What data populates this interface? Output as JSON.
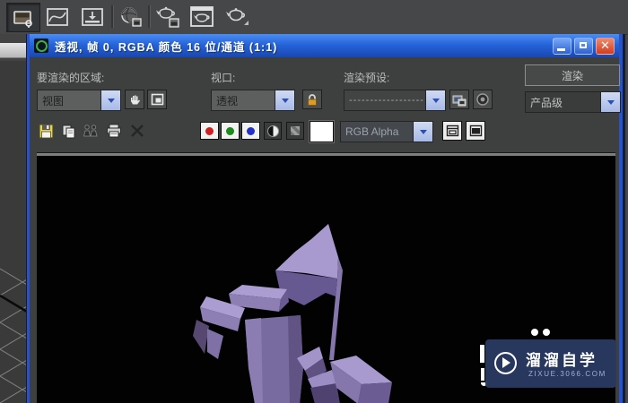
{
  "background_toolbar": {
    "icons": [
      "snapshot-flyout",
      "curve-editor",
      "layer-manager",
      "material-editor",
      "render-setup",
      "rendered-frame-window",
      "render-production"
    ]
  },
  "window": {
    "title": "透视, 帧 0, RGBA 颜色 16 位/通道 (1:1)",
    "window_buttons": {
      "minimize": "minimize",
      "maximize": "maximize",
      "close": "close"
    },
    "controls": {
      "area_to_render_label": "要渲染的区域:",
      "area_to_render_value": "视图",
      "viewport_label": "视口:",
      "viewport_value": "透视",
      "render_preset_label": "渲染预设:",
      "render_preset_value": "------------------",
      "render_button_label": "渲染",
      "render_mode_value": "产品级",
      "channel_display_value": "RGB Alpha"
    },
    "frame_toolbar_icons": [
      "save-image",
      "copy-image",
      "clone-rendered-frame-window",
      "print-image",
      "clear",
      "enable-red-channel",
      "enable-green-channel",
      "enable-blue-channel",
      "display-monochrome",
      "display-alpha-channel",
      "background-color-swatch",
      "channel-display-dropdown",
      "toggle-ui-overlays",
      "toggle-ui"
    ],
    "render_view": {
      "background": "#000000",
      "object_colors": {
        "light": "#a89ace",
        "mid": "#8577ab",
        "dark": "#665890",
        "darkest": "#4f4270"
      }
    },
    "watermark": {
      "brand": "溜溜自学",
      "site": "zixue.3066.com"
    }
  },
  "colors": {
    "titlebar_top": "#4c8cf4",
    "titlebar_bottom": "#1a47b0",
    "window_border": "#2a52c8",
    "panel": "#3e4040",
    "close_red": "#d23c20",
    "combo_arrow": "#b9c7ea",
    "red_channel": "#cf2020",
    "green_channel": "#1c8a1c",
    "blue_channel": "#2430c8",
    "lock_orange": "#e09a2a"
  }
}
